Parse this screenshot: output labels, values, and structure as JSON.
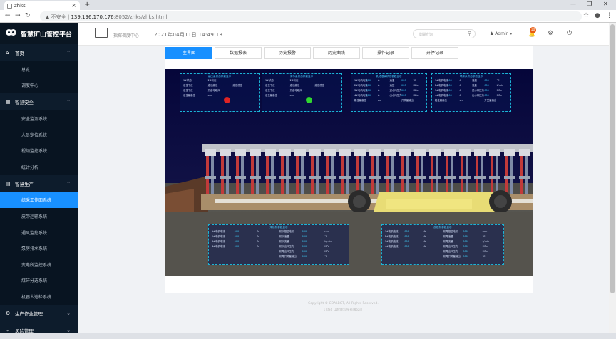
{
  "browser": {
    "tab_title": "zhks",
    "url_insecure": "不安全",
    "url_host": "139.196.170.176",
    "url_port_path": ":8052/zhks/zhks.html"
  },
  "app": {
    "title": "智慧矿山管控平台"
  },
  "sidebar": {
    "groups": [
      {
        "label": "首页",
        "icon": "home-icon",
        "items": [
          "总览",
          "调度中心"
        ]
      },
      {
        "label": "智慧安全",
        "icon": "grid-icon",
        "items": [
          "安全监测系统",
          "人员定位系统",
          "视频监控系统",
          "统计分析"
        ]
      },
      {
        "label": "智慧生产",
        "icon": "chart-icon",
        "items": [
          "综采工作面系统",
          "皮带运输系统",
          "通风监控系统",
          "泵房排水系统",
          "变电所监控系统",
          "煤矸分选系统",
          "机器人巡检系统"
        ]
      },
      {
        "label": "生产作业管理",
        "icon": "gear-icon",
        "items": []
      },
      {
        "label": "风险管理",
        "icon": "shield-icon",
        "items": []
      }
    ],
    "active_item": "综采工作面系统"
  },
  "header": {
    "center_label": "指挥调度中心",
    "datetime": "2021年04月11日 14:49:18",
    "search_placeholder": "模糊查询",
    "user": "Admin",
    "notifications": "10"
  },
  "tabs": [
    "主界面",
    "数据报表",
    "历史报警",
    "历史曲线",
    "操作记录",
    "开停记录"
  ],
  "active_tab": "主界面",
  "panels": {
    "p1": {
      "title": "高压泵状态参数显示",
      "rows": [
        [
          "1#状态",
          "2#状态"
        ],
        [
          "液位下位",
          "液位高位",
          "液位低位"
        ],
        [
          "液位下位",
          "开启电磁阀"
        ],
        [
          "液位最高位",
          "cm"
        ]
      ]
    },
    "p2": {
      "title": "清水泵状态参数显示",
      "rows": [
        [
          "1#状态",
          "2#状态"
        ],
        [
          "液位下位",
          "液位高位",
          "液位低位"
        ],
        [
          "液位下位",
          "开启电磁阀"
        ],
        [
          "液位最高位",
          "cm"
        ]
      ]
    },
    "p3": {
      "title": "乳化液泵状态参数显示",
      "rows": [
        [
          "1#电机电流",
          "000",
          "A",
          "油温",
          "000",
          "℃"
        ],
        [
          "2#电机电流",
          "000",
          "A",
          "油压",
          "000",
          "MPa"
        ],
        [
          "3#电机电流",
          "000",
          "A",
          "进水口压力",
          "000",
          "MPa"
        ],
        [
          "4#电机电流",
          "000",
          "A",
          "出水口压力",
          "000",
          "MPa"
        ],
        [
          "箱位最高位",
          "cm",
          "开关量输出"
        ]
      ]
    },
    "p4": {
      "title": "喷雾泵状态参数显示",
      "rows": [
        [
          "1#电机电流",
          "000",
          "A",
          "油温",
          "000",
          "℃"
        ],
        [
          "2#电机电流",
          "000",
          "A",
          "流量",
          "000",
          "L/min"
        ],
        [
          "3#电机电流",
          "000",
          "A",
          "进水口压力",
          "000",
          "MPa"
        ],
        [
          "4#电机电流",
          "000",
          "A",
          "出水口压力",
          "000",
          "MPa"
        ],
        [
          "箱位最高位",
          "cm",
          "开关量输出"
        ]
      ]
    },
    "p5": {
      "title": "采煤机参数显示",
      "rows": [
        [
          "1#电机电流",
          "000",
          "A",
          "机头推进电机",
          "000",
          "mm"
        ],
        [
          "2#电机电流",
          "000",
          "A",
          "机头油温",
          "000",
          "℃"
        ],
        [
          "3#电机电流",
          "000",
          "A",
          "机头流量",
          "000",
          "L/min"
        ],
        [
          "4#电机电流",
          "000",
          "A",
          "机头出口压力",
          "000",
          "MPa"
        ],
        [
          "",
          "",
          "",
          "机尾出口压力",
          "000",
          "MPa"
        ],
        [
          "",
          "",
          "",
          "机尾开关量输出",
          "000",
          "℃"
        ]
      ]
    },
    "p6": {
      "title": "刮板机参数显示",
      "rows": [
        [
          "1#电机电流",
          "000",
          "A",
          "机尾推进电机",
          "000",
          "mm"
        ],
        [
          "2#电机电流",
          "000",
          "A",
          "机尾油温",
          "000",
          "℃"
        ],
        [
          "3#电机电流",
          "000",
          "A",
          "机尾流量",
          "000",
          "L/min"
        ],
        [
          "4#电机电流",
          "000",
          "A",
          "机尾出口压力",
          "000",
          "MPa"
        ],
        [
          "",
          "",
          "",
          "机尾出口压力",
          "000",
          "MPa"
        ],
        [
          "",
          "",
          "",
          "机尾开关量输出",
          "000",
          "℃"
        ]
      ]
    }
  },
  "footer": {
    "copyright": "Copyright © COALBOT, All Rights Reserved.",
    "company": "江苏矿山智能科技有限公司"
  }
}
